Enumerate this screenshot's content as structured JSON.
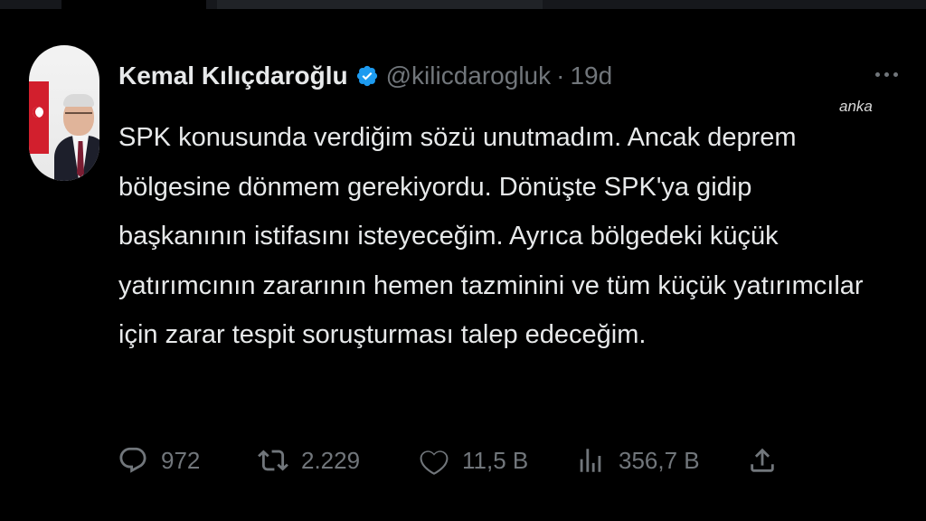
{
  "tweet": {
    "author_name": "Kemal Kılıçdaroğlu",
    "handle": "@kilicdarogluk",
    "separator": "·",
    "time": "19d",
    "text": "SPK konusunda verdiğim sözü unutmadım. Ancak deprem bölgesine dönmem gerekiyordu. Dönüşte SPK'ya gidip başkanının istifasını isteyeceğim. Ayrıca bölgedeki küçük yatırımcının zararının hemen tazminini ve tüm küçük yatırımcılar için zarar tespit soruşturması talep edeceğim."
  },
  "watermark": "anka",
  "actions": {
    "replies": "972",
    "retweets": "2.229",
    "likes": "11,5 B",
    "views": "356,7 B"
  },
  "icons": {
    "verified": "verified-badge-icon",
    "more": "more-options-icon",
    "reply": "reply-icon",
    "retweet": "retweet-icon",
    "like": "heart-icon",
    "views": "views-icon",
    "share": "share-icon"
  },
  "colors": {
    "background": "#000000",
    "text": "#e7e9ea",
    "muted": "#71767b",
    "verified": "#1d9bf0"
  }
}
